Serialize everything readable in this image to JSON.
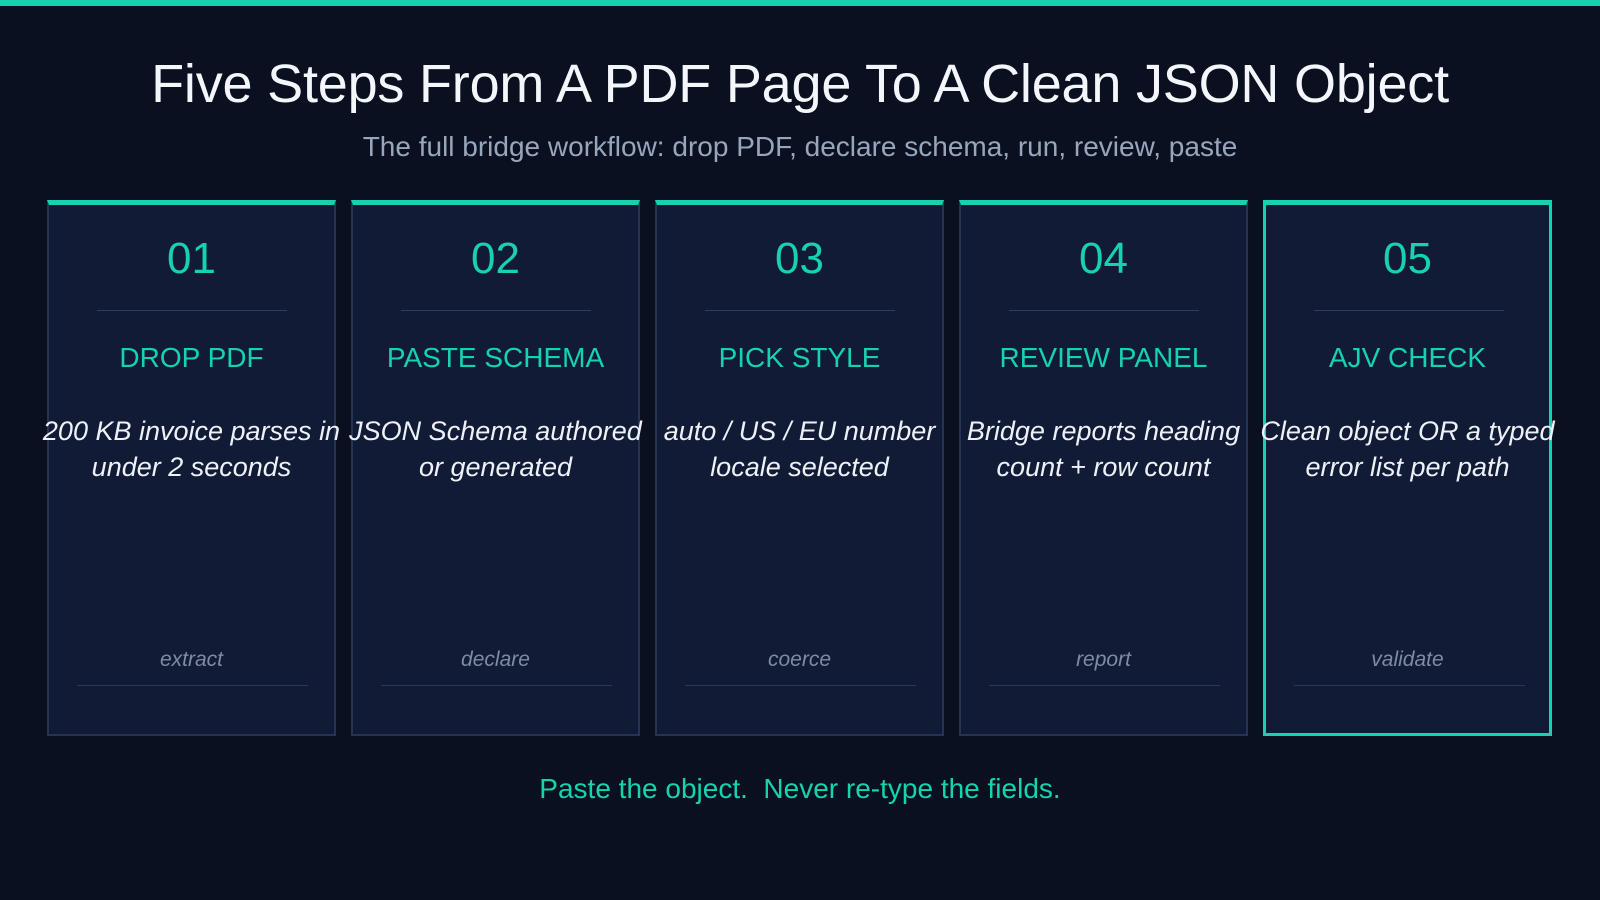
{
  "header": {
    "title": "Five Steps From A PDF Page To A Clean JSON Object",
    "subtitle": "The full bridge workflow: drop PDF, declare schema, run, review, paste"
  },
  "steps": [
    {
      "number": "01",
      "title": "DROP PDF",
      "description": "200 KB invoice parses in under 2 seconds",
      "verb": "extract"
    },
    {
      "number": "02",
      "title": "PASTE SCHEMA",
      "description": "JSON Schema authored or generated",
      "verb": "declare"
    },
    {
      "number": "03",
      "title": "PICK STYLE",
      "description": "auto / US / EU number locale selected",
      "verb": "coerce"
    },
    {
      "number": "04",
      "title": "REVIEW PANEL",
      "description": "Bridge reports heading count + row count",
      "verb": "report"
    },
    {
      "number": "05",
      "title": "AJV CHECK",
      "description": "Clean object OR a typed error list per path",
      "verb": "validate"
    }
  ],
  "footer": {
    "tagline": "Paste the object.  Never re-type the fields."
  },
  "colors": {
    "background": "#0a1020",
    "accent": "#16d3b0",
    "card": "#111b36",
    "card_border": "#263454"
  }
}
